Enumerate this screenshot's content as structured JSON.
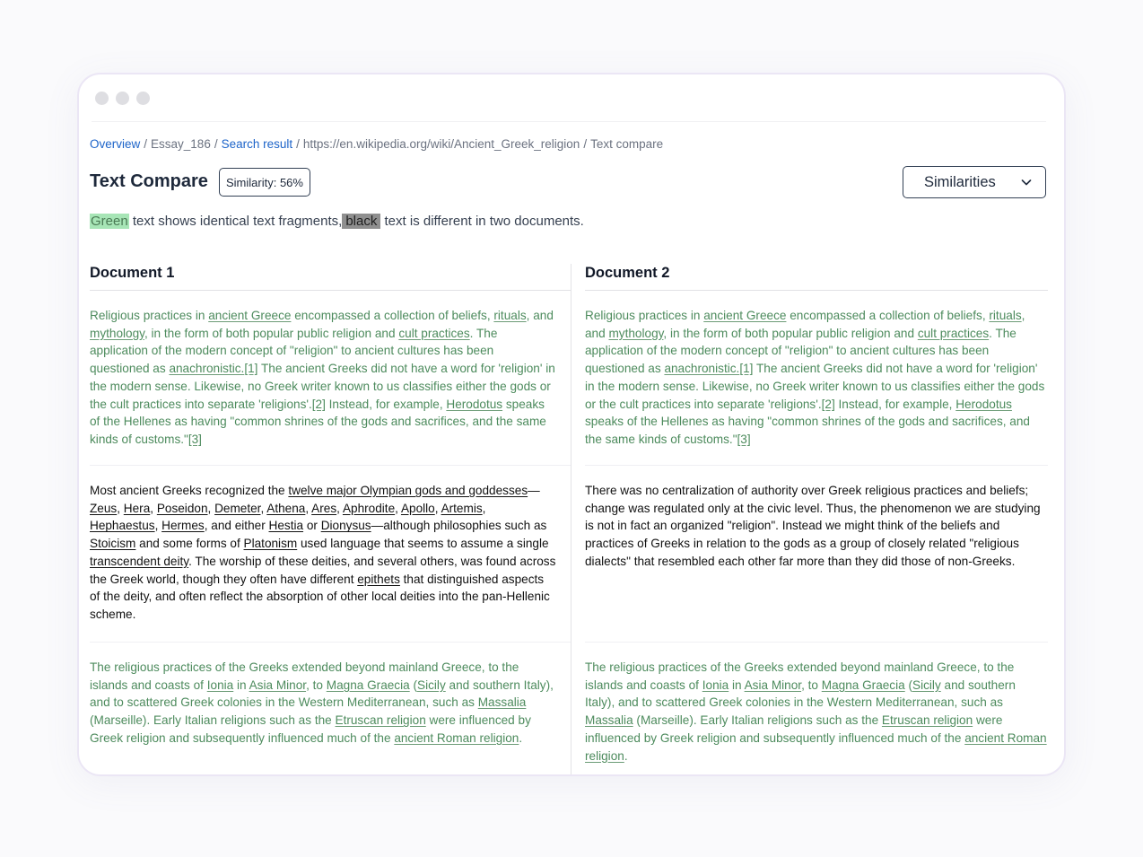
{
  "window": {
    "controls": [
      "close",
      "minimize",
      "maximize"
    ]
  },
  "breadcrumb": [
    {
      "label": "Overview",
      "link": true
    },
    {
      "label": "Essay_186",
      "link": false
    },
    {
      "label": "Search result",
      "link": true
    },
    {
      "label": "https://en.wikipedia.org/wiki/Ancient_Greek_religion",
      "link": false
    },
    {
      "label": "Text compare",
      "link": false
    }
  ],
  "breadcrumb_separator": "/",
  "header": {
    "title": "Text Compare",
    "similarity_badge": "Similarity: 56%",
    "view_dropdown": {
      "selected": "Similarities",
      "icon": "chevron-down-icon"
    }
  },
  "legend": {
    "green_word": "Green",
    "green_text": " text shows identical text fragments,",
    "black_word": "black",
    "black_text": " text is different in two documents."
  },
  "colors": {
    "identical_text": "#4d8b5d",
    "different_text": "#111111",
    "link": "#1d64c9",
    "green_highlight": "#a7e5b6",
    "black_highlight": "#8f8f8f"
  },
  "documents": [
    {
      "heading": "Document 1",
      "segments": [
        {
          "type": "identical",
          "parts": [
            {
              "t": "Religious practices in "
            },
            {
              "t": "ancient Greece",
              "u": true
            },
            {
              "t": " encompassed a collection of beliefs, "
            },
            {
              "t": "rituals",
              "u": true
            },
            {
              "t": ", and "
            },
            {
              "t": "mythology",
              "u": true
            },
            {
              "t": ", in the form of both popular public religion and "
            },
            {
              "t": "cult practices",
              "u": true
            },
            {
              "t": ". The application of the modern concept of \"religion\" to ancient cultures has been questioned as "
            },
            {
              "t": "anachronistic.",
              "u": true
            },
            {
              "t": "[1]",
              "u": true
            },
            {
              "t": " The ancient Greeks did not have a word for 'religion' in the modern sense. Likewise, no Greek writer known to us classifies either the gods or the cult practices into separate 'religions'."
            },
            {
              "t": "[2]",
              "u": true
            },
            {
              "t": " Instead, for example, "
            },
            {
              "t": "Herodotus",
              "u": true
            },
            {
              "t": " speaks of the Hellenes as having \"common shrines of the gods and sacrifices, and the same kinds of customs.\""
            },
            {
              "t": "[3]",
              "u": true
            }
          ]
        },
        {
          "type": "different",
          "parts": [
            {
              "t": "Most ancient Greeks recognized the "
            },
            {
              "t": "twelve major Olympian gods and goddesses",
              "u": true
            },
            {
              "t": "— "
            },
            {
              "t": "Zeus",
              "u": true
            },
            {
              "t": ", "
            },
            {
              "t": "Hera",
              "u": true
            },
            {
              "t": ", "
            },
            {
              "t": "Poseidon",
              "u": true
            },
            {
              "t": ", "
            },
            {
              "t": "Demeter",
              "u": true
            },
            {
              "t": ", "
            },
            {
              "t": "Athena",
              "u": true
            },
            {
              "t": ", "
            },
            {
              "t": "Ares",
              "u": true
            },
            {
              "t": ", "
            },
            {
              "t": "Aphrodite",
              "u": true
            },
            {
              "t": ", "
            },
            {
              "t": "Apollo",
              "u": true
            },
            {
              "t": ", "
            },
            {
              "t": "Artemis",
              "u": true
            },
            {
              "t": ", "
            },
            {
              "t": "Hephaestus",
              "u": true
            },
            {
              "t": ", "
            },
            {
              "t": "Hermes",
              "u": true
            },
            {
              "t": ", and either "
            },
            {
              "t": "Hestia",
              "u": true
            },
            {
              "t": " or "
            },
            {
              "t": "Dionysus",
              "u": true
            },
            {
              "t": "—although philosophies such as "
            },
            {
              "t": "Stoicism",
              "u": true
            },
            {
              "t": " and some forms of "
            },
            {
              "t": "Platonism",
              "u": true
            },
            {
              "t": " used language that seems to assume a single "
            },
            {
              "t": "transcendent deity",
              "u": true
            },
            {
              "t": ". The worship of these deities, and several others, was found across the Greek world, though they often have different "
            },
            {
              "t": "epithets",
              "u": true
            },
            {
              "t": " that distinguished aspects of the deity, and often reflect the absorption of other local deities into the pan-Hellenic scheme."
            }
          ]
        },
        {
          "type": "identical",
          "parts": [
            {
              "t": "The religious practices of the Greeks extended beyond mainland Greece, to the islands and coasts of "
            },
            {
              "t": "Ionia",
              "u": true
            },
            {
              "t": " in "
            },
            {
              "t": "Asia Minor",
              "u": true
            },
            {
              "t": ", to "
            },
            {
              "t": "Magna Graecia",
              "u": true
            },
            {
              "t": " ("
            },
            {
              "t": "Sicily",
              "u": true
            },
            {
              "t": " and southern Italy), and to scattered Greek colonies in the Western Mediterranean, such as "
            },
            {
              "t": "Massalia",
              "u": true
            },
            {
              "t": " (Marseille). Early Italian religions such as the "
            },
            {
              "t": "Etruscan religion",
              "u": true
            },
            {
              "t": " were influenced by Greek religion and subsequently influenced much of the "
            },
            {
              "t": "ancient Roman religion",
              "u": true
            },
            {
              "t": "."
            }
          ]
        }
      ]
    },
    {
      "heading": "Document 2",
      "segments": [
        {
          "type": "identical",
          "parts": [
            {
              "t": "Religious practices in "
            },
            {
              "t": "ancient Greece",
              "u": true
            },
            {
              "t": " encompassed a collection of beliefs, "
            },
            {
              "t": "rituals",
              "u": true
            },
            {
              "t": ", and "
            },
            {
              "t": "mythology",
              "u": true
            },
            {
              "t": ", in the form of both popular public religion and "
            },
            {
              "t": "cult practices",
              "u": true
            },
            {
              "t": ". The application of the modern concept of \"religion\" to ancient cultures has been questioned as "
            },
            {
              "t": "anachronistic.",
              "u": true
            },
            {
              "t": "[1]",
              "u": true
            },
            {
              "t": " The ancient Greeks did not have a word for 'religion' in the modern sense. Likewise, no Greek writer known to us classifies either the gods or the cult practices into separate 'religions'."
            },
            {
              "t": "[2]",
              "u": true
            },
            {
              "t": " Instead, for example, "
            },
            {
              "t": "Herodotus",
              "u": true
            },
            {
              "t": " speaks of the Hellenes as having \"common shrines of the gods and sacrifices, and the same kinds of customs.\""
            },
            {
              "t": "[3]",
              "u": true
            }
          ]
        },
        {
          "type": "different",
          "parts": [
            {
              "t": "There was no centralization of authority over Greek religious practices and beliefs; change was regulated only at the civic level. Thus, the phenomenon we are studying is not in fact an organized \"religion\". Instead we might think of the beliefs and practices of Greeks in relation to the gods as a group of closely related \"religious dialects\" that resembled each other far more than they did those of non-Greeks."
            }
          ]
        },
        {
          "type": "identical",
          "parts": [
            {
              "t": "The religious practices of the Greeks extended beyond mainland Greece, to the islands and coasts of "
            },
            {
              "t": "Ionia",
              "u": true
            },
            {
              "t": " in "
            },
            {
              "t": "Asia Minor",
              "u": true
            },
            {
              "t": ", to "
            },
            {
              "t": "Magna Graecia",
              "u": true
            },
            {
              "t": " ("
            },
            {
              "t": "Sicily",
              "u": true
            },
            {
              "t": " and southern Italy), and to scattered Greek colonies in the Western Mediterranean, such as "
            },
            {
              "t": "Massalia",
              "u": true
            },
            {
              "t": " (Marseille). Early Italian religions such as the "
            },
            {
              "t": "Etruscan religion",
              "u": true
            },
            {
              "t": " were influenced by Greek religion and subsequently influenced much of the "
            },
            {
              "t": "ancient Roman religion",
              "u": true
            },
            {
              "t": "."
            }
          ]
        }
      ]
    }
  ]
}
